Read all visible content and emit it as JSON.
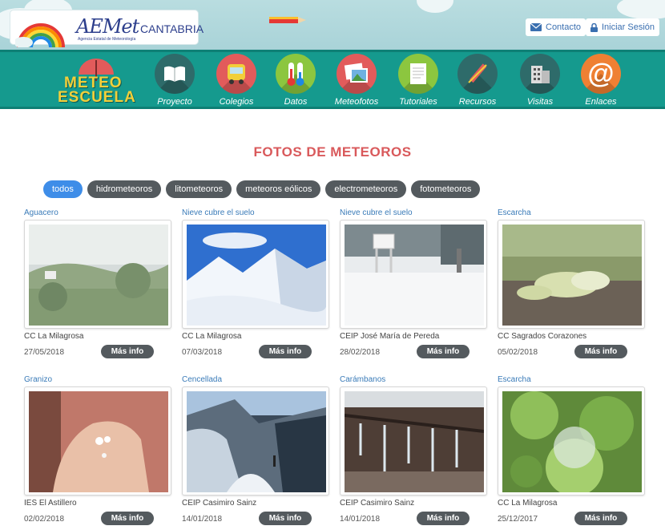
{
  "header": {
    "brand": "AEMet",
    "brand_sub": "Agencia Estatal de Meteorología",
    "region": "CANTABRIA",
    "contact_label": "Contacto",
    "login_label": "Iniciar Sesión"
  },
  "nav": {
    "logo_line1": "METEO",
    "logo_line2": "ESCUELA",
    "items": [
      {
        "label": "Proyecto",
        "icon": "book-icon",
        "color": "#2e6b6a"
      },
      {
        "label": "Colegios",
        "icon": "school-bus-icon",
        "color": "#e25b5b"
      },
      {
        "label": "Datos",
        "icon": "thermometer-icon",
        "color": "#8cc63f"
      },
      {
        "label": "Meteofotos",
        "icon": "photos-icon",
        "color": "#e25b5b"
      },
      {
        "label": "Tutoriales",
        "icon": "document-icon",
        "color": "#8cc63f"
      },
      {
        "label": "Recursos",
        "icon": "pencil-icon",
        "color": "#2e6b6a"
      },
      {
        "label": "Visitas",
        "icon": "building-icon",
        "color": "#2e6b6a"
      },
      {
        "label": "Enlaces",
        "icon": "at-icon",
        "color": "#ef8033"
      }
    ]
  },
  "page": {
    "title": "FOTOS DE METEOROS",
    "filters": [
      "todos",
      "hidrometeoros",
      "litometeoros",
      "meteoros eólicos",
      "electrometeoros",
      "fotometeoros"
    ],
    "active_filter": "todos",
    "more_label": "Más info"
  },
  "photos": [
    {
      "category": "Aguacero",
      "school": "CC La Milagrosa",
      "date": "27/05/2018"
    },
    {
      "category": "Nieve cubre el suelo",
      "school": "CC La Milagrosa",
      "date": "07/03/2018"
    },
    {
      "category": "Nieve cubre el suelo",
      "school": "CEIP José María de Pereda",
      "date": "28/02/2018"
    },
    {
      "category": "Escarcha",
      "school": "CC Sagrados Corazones",
      "date": "05/02/2018"
    },
    {
      "category": "Granizo",
      "school": "IES El Astillero",
      "date": "02/02/2018"
    },
    {
      "category": "Cencellada",
      "school": "CEIP Casimiro Sainz",
      "date": "14/01/2018"
    },
    {
      "category": "Carámbanos",
      "school": "CEIP Casimiro Sainz",
      "date": "14/01/2018"
    },
    {
      "category": "Escarcha",
      "school": "CC La Milagrosa",
      "date": "25/12/2017"
    }
  ]
}
